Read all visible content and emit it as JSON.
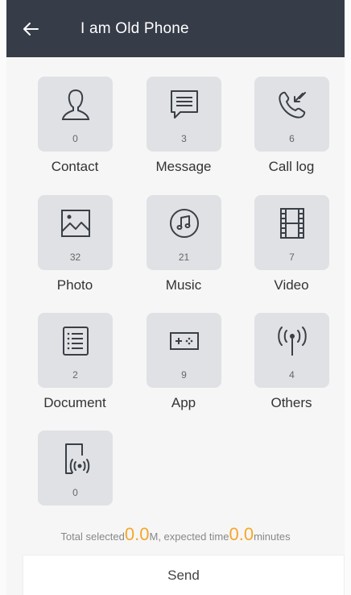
{
  "header": {
    "title": "I am Old Phone",
    "back_icon": "arrow-left-icon"
  },
  "items": [
    {
      "label": "Contact",
      "count": "0",
      "icon": "person-icon"
    },
    {
      "label": "Message",
      "count": "3",
      "icon": "message-icon"
    },
    {
      "label": "Call log",
      "count": "6",
      "icon": "phone-call-icon"
    },
    {
      "label": "Photo",
      "count": "32",
      "icon": "image-icon"
    },
    {
      "label": "Music",
      "count": "21",
      "icon": "music-note-icon"
    },
    {
      "label": "Video",
      "count": "7",
      "icon": "film-icon"
    },
    {
      "label": "Document",
      "count": "2",
      "icon": "document-list-icon"
    },
    {
      "label": "App",
      "count": "9",
      "icon": "gamepad-icon"
    },
    {
      "label": "Others",
      "count": "4",
      "icon": "antenna-icon"
    },
    {
      "label": "",
      "count": "0",
      "icon": "phone-signal-icon"
    }
  ],
  "summary": {
    "prefix": "Total selected",
    "size_value": "0.0",
    "size_unit": "M, expected time",
    "time_value": "0.0",
    "time_unit": "minutes"
  },
  "send_label": "Send",
  "colors": {
    "header_bg": "#363c48",
    "tile_bg": "#dfe1e4",
    "accent": "#f7a62b"
  }
}
